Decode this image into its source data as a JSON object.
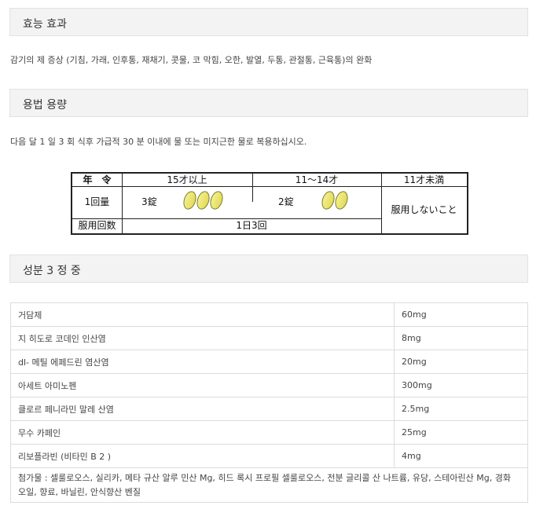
{
  "efficacy": {
    "heading": "효능 효과",
    "text": "감기의 제 증상 (기침, 가래, 인후통, 재채기, 콧물, 코 막힘, 오한, 발열, 두통, 관절통, 근육통)의 완화"
  },
  "dosage": {
    "heading": "용법 용량",
    "text": "다음 달 1 일 3 회 식후 가급적 30 분 이내에 물 또는 미지근한 물로 복용하십시오.",
    "table": {
      "age_label": "年　令",
      "col_15up": "15才以上",
      "col_11_14": "11〜14才",
      "col_under11": "11才未満",
      "dose_label": "1回量",
      "dose_15up": "3錠",
      "dose_11_14": "2錠",
      "dose_under11": "服用しないこと",
      "freq_label": "服用回数",
      "freq_value": "1日3回",
      "pill_count_15up": 3,
      "pill_count_11_14": 2
    }
  },
  "ingredients": {
    "heading": "성분 3 정 중",
    "rows": [
      {
        "name": "거담제",
        "amount": "60mg"
      },
      {
        "name": "지 히도로 코데인 인산염",
        "amount": "8mg"
      },
      {
        "name": "dl- 메틸 에페드린 염산염",
        "amount": "20mg"
      },
      {
        "name": "아세트 아미노펜",
        "amount": "300mg"
      },
      {
        "name": "클로르 페니라민 말레 산염",
        "amount": "2.5mg"
      },
      {
        "name": "무수 카페인",
        "amount": "25mg"
      },
      {
        "name": "리보플라빈 (비타민 B 2 )",
        "amount": "4mg"
      }
    ],
    "additives": "첨가물 : 셀룰로오스, 실리카, 메타 규산 알루 민산 Mg, 히드 록시 프로필 셀룰로오스, 전분 글리콜 산 나트륨, 유당, 스테아린산 Mg, 경화 오일, 향료, 바닐린, 안식향산 벤질"
  }
}
